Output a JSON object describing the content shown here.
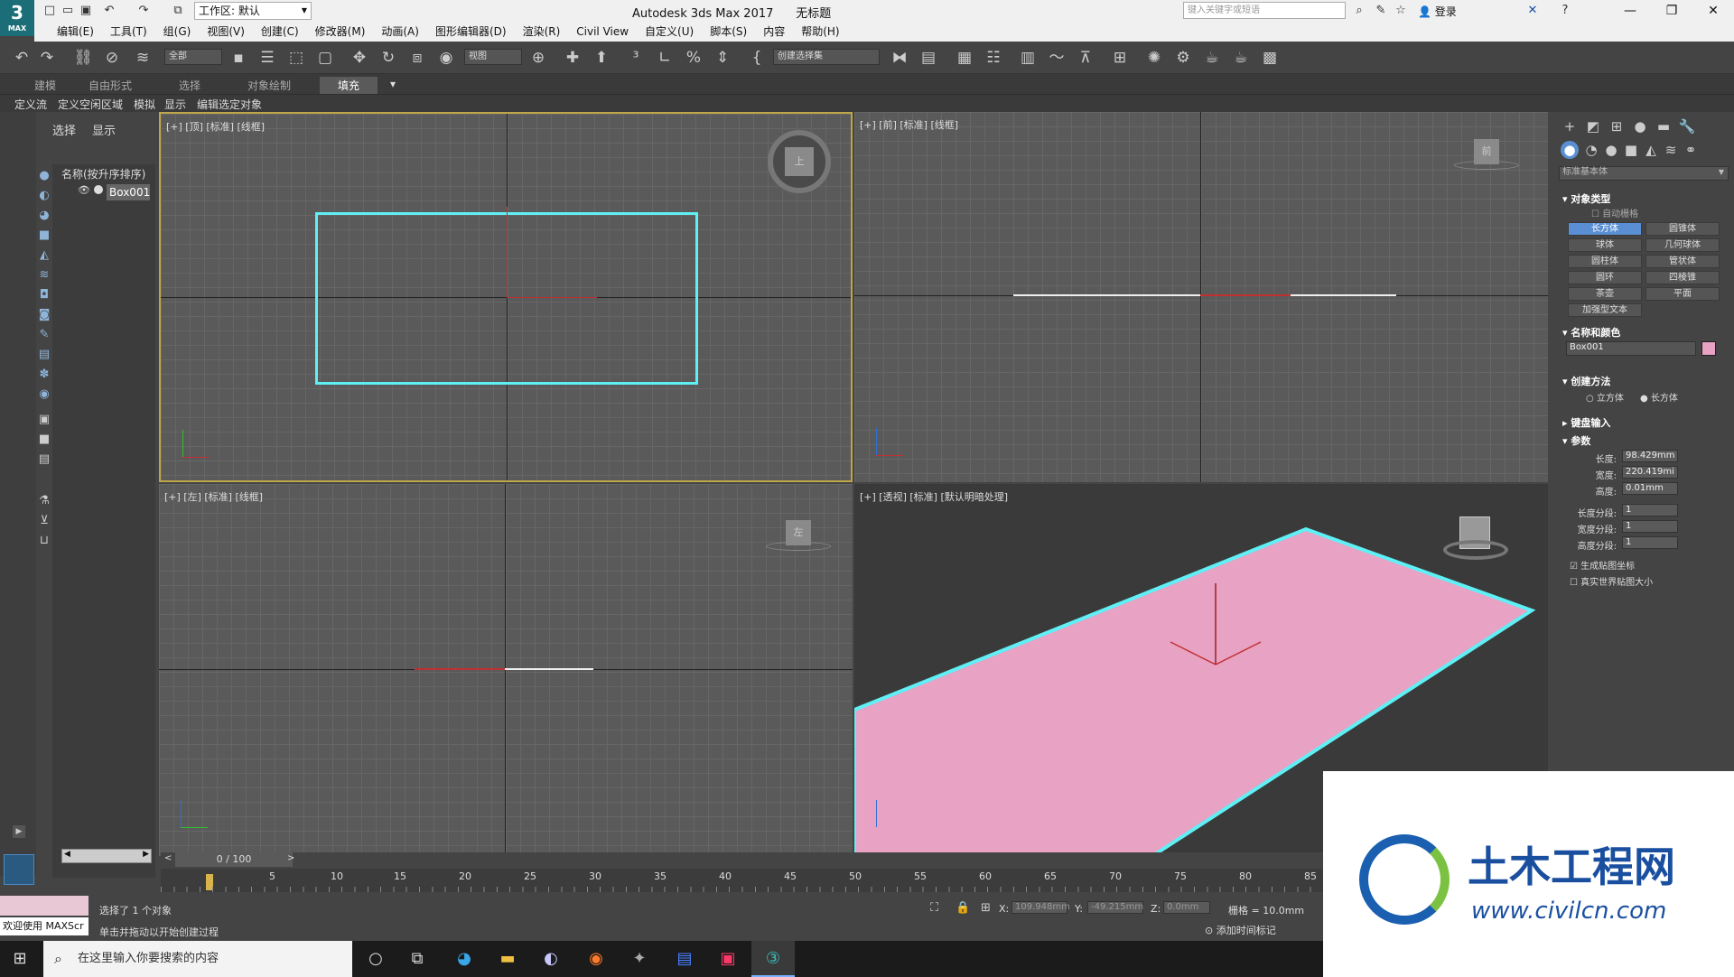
{
  "app": {
    "title": "Autodesk 3ds Max 2017",
    "doc": "无标题",
    "logo_num": "3",
    "logo_text": "MAX"
  },
  "workspace": "工作区: 默认",
  "search_placeholder": "键入关键字或短语",
  "login": "登录",
  "menus": [
    "编辑(E)",
    "工具(T)",
    "组(G)",
    "视图(V)",
    "创建(C)",
    "修改器(M)",
    "动画(A)",
    "图形编辑器(D)",
    "渲染(R)",
    "Civil View",
    "自定义(U)",
    "脚本(S)",
    "内容",
    "帮助(H)"
  ],
  "toolbar": {
    "filter": "全部",
    "ref_coord": "视图",
    "selection_set": "创建选择集"
  },
  "ribbon_tabs": [
    "建模",
    "自由形式",
    "选择",
    "对象绘制",
    "填充"
  ],
  "scene_tabs": [
    "定义流",
    "定义空闲区域",
    "模拟",
    "显示",
    "编辑选定对象"
  ],
  "explorer": {
    "tabs": [
      "选择",
      "显示"
    ],
    "sort_header": "名称(按升序排序)",
    "item": "Box001"
  },
  "viewports": {
    "top": "[+] [顶] [标准] [线框]",
    "front": "[+] [前] [标准] [线框]",
    "left": "[+] [左] [标准] [线框]",
    "persp": "[+] [透视] [标准] [默认明暗处理]",
    "cube_top": "上",
    "cube_front": "前",
    "cube_left": "左"
  },
  "command_panel": {
    "dropdown": "标准基本体",
    "rollout_object_type": "对象类型",
    "autogrid": "自动栅格",
    "buttons": [
      "长方体",
      "圆锥体",
      "球体",
      "几何球体",
      "圆柱体",
      "管状体",
      "圆环",
      "四棱锥",
      "茶壶",
      "平面",
      "加强型文本"
    ],
    "rollout_name_color": "名称和颜色",
    "name_value": "Box001",
    "rollout_create_method": "创建方法",
    "method_cube": "立方体",
    "method_box": "长方体",
    "rollout_keyboard": "键盘输入",
    "rollout_params": "参数",
    "length_label": "长度:",
    "length": "98.429mm",
    "width_label": "宽度:",
    "width": "220.419mi",
    "height_label": "高度:",
    "height": "0.01mm",
    "lseg_label": "长度分段:",
    "lseg": "1",
    "wseg_label": "宽度分段:",
    "wseg": "1",
    "hseg_label": "高度分段:",
    "hseg": "1",
    "gen_map": "生成贴图坐标",
    "real_world": "真实世界贴图大小"
  },
  "timeline": {
    "frame": "0 / 100",
    "ticks": [
      "5",
      "10",
      "15",
      "20",
      "25",
      "30",
      "35",
      "40",
      "45",
      "50",
      "55",
      "60",
      "65",
      "70",
      "75",
      "80",
      "85"
    ]
  },
  "status": {
    "welcome": "欢迎使用 MAXScr",
    "selected": "选择了 1 个对象",
    "prompt": "单击并拖动以开始创建过程",
    "x_label": "X:",
    "x": "109.948mm",
    "y_label": "Y:",
    "y": "-49.215mm",
    "z_label": "Z:",
    "z": "0.0mm",
    "grid": "栅格 = 10.0mm",
    "add_tag": "添加时间标记"
  },
  "taskbar": {
    "search": "在这里输入你要搜索的内容"
  },
  "watermark": {
    "cn": "土木工程网",
    "url": "www.civilcn.com"
  },
  "colors": {
    "object": "#e8a2c4",
    "selection": "#5ff0f5",
    "accent": "#5b8fd4"
  }
}
